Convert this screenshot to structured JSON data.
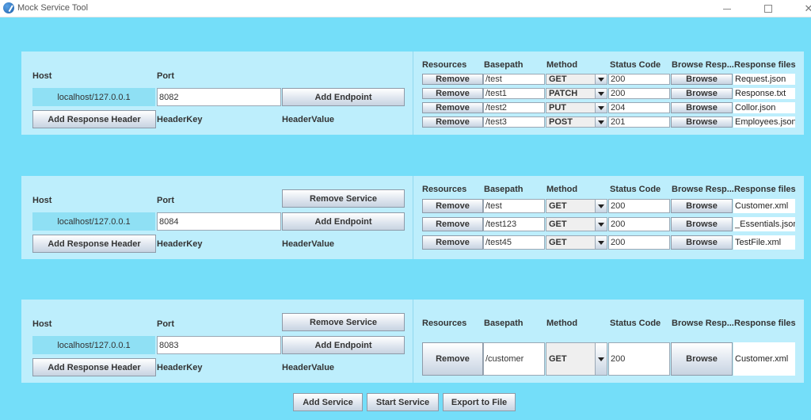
{
  "window": {
    "title": "Mock Service Tool",
    "controls": [
      "minimize",
      "maximize",
      "close"
    ]
  },
  "labels": {
    "host": "Host",
    "port": "Port",
    "header_key": "HeaderKey",
    "header_value": "HeaderValue",
    "add_endpoint": "Add Endpoint",
    "add_response_header": "Add Response Header",
    "remove_service": "Remove Service",
    "remove": "Remove",
    "browse": "Browse"
  },
  "table_headers": [
    "Resources",
    "Basepath",
    "Method",
    "Status Code",
    "Browse Resp...",
    "Response files"
  ],
  "services": [
    {
      "host": "localhost/127.0.0.1",
      "port": "8082",
      "show_remove_service": false,
      "endpoints": [
        {
          "basepath": "/test",
          "method": "GET",
          "status": "200",
          "file": "Request.json"
        },
        {
          "basepath": "/test1",
          "method": "PATCH",
          "status": "200",
          "file": "Response.txt"
        },
        {
          "basepath": "/test2",
          "method": "PUT",
          "status": "204",
          "file": "Collor.json"
        },
        {
          "basepath": "/test3",
          "method": "POST",
          "status": "201",
          "file": "Employees.json"
        }
      ]
    },
    {
      "host": "localhost/127.0.0.1",
      "port": "8084",
      "show_remove_service": true,
      "endpoints": [
        {
          "basepath": "/test",
          "method": "GET",
          "status": "200",
          "file": "Customer.xml"
        },
        {
          "basepath": "/test123",
          "method": "GET",
          "status": "200",
          "file": "_Essentials.json"
        },
        {
          "basepath": "/test45",
          "method": "GET",
          "status": "200",
          "file": "TestFile.xml"
        }
      ]
    },
    {
      "host": "localhost/127.0.0.1",
      "port": "8083",
      "show_remove_service": true,
      "endpoints": [
        {
          "basepath": "/customer",
          "method": "GET",
          "status": "200",
          "file": "Customer.xml"
        }
      ]
    }
  ],
  "footer": {
    "add_service": "Add Service",
    "start_service": "Start Service",
    "export_to_file": "Export to File"
  },
  "colors": {
    "background": "#74def9",
    "panel": "#bdeefc",
    "host_field": "#8fe0f4"
  }
}
